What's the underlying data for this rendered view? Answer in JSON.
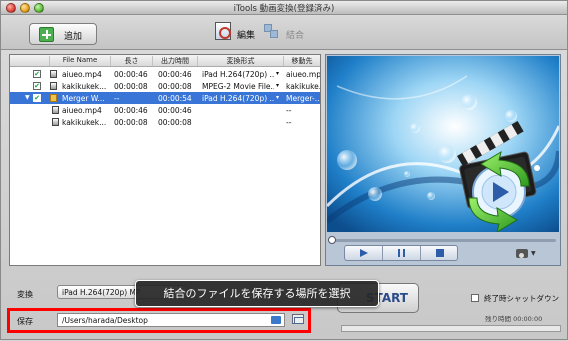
{
  "window": {
    "title": "iTools 動画変換(登録済み)"
  },
  "toolbar": {
    "add_label": "追加",
    "edit_label": "編集",
    "join_label": "結合"
  },
  "list": {
    "headers": [
      "File Name",
      "長さ",
      "出力時間",
      "変換形式",
      "移動先"
    ],
    "rows": [
      {
        "checked": true,
        "name": "aiueo.mp4",
        "length": "00:00:46",
        "output": "00:00:46",
        "format": "iPad H.264(720p) ...",
        "dest": "aiueo.mp4",
        "selected": false
      },
      {
        "checked": true,
        "name": "kakikukek...",
        "length": "00:00:08",
        "output": "00:00:08",
        "format": "MPEG-2 Movie File...",
        "dest": "kakikuke...",
        "selected": false
      },
      {
        "checked": true,
        "name": "Merger W...",
        "length": "--",
        "output": "00:00:54",
        "format": "iPad H.264(720p) ...",
        "dest": "Merger-...",
        "selected": true
      },
      {
        "checked": false,
        "name": "aiueo.mp4",
        "length": "00:00:46",
        "output": "00:00:46",
        "format": "",
        "dest": "--",
        "selected": false
      },
      {
        "checked": false,
        "name": "kakikukek...",
        "length": "00:00:08",
        "output": "00:00:08",
        "format": "",
        "dest": "--",
        "selected": false
      }
    ]
  },
  "bottom": {
    "convert_label": "変換",
    "convert_value": "iPad H.264(720p) MP",
    "save_label": "保存",
    "save_path": "/Users/harada/Desktop",
    "start_label": "START",
    "shutdown_label": "終了時シャットダウン",
    "remaining_label": "残り時間 00:00:00"
  },
  "tooltip": {
    "text": "結合のファイルを保存する場所を選択"
  },
  "colors": {
    "selection": "#3875d7",
    "highlight_box": "#ff0000",
    "accent": "#2d5da8"
  }
}
